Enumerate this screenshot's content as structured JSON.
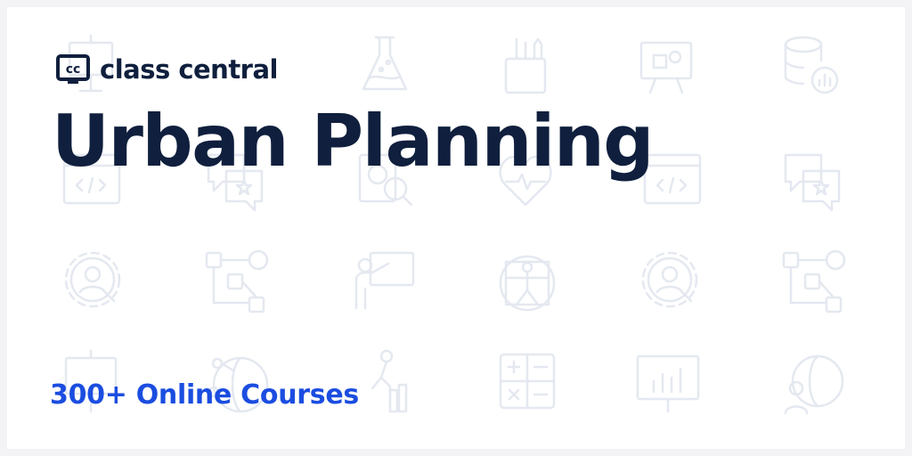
{
  "brand": {
    "name": "class central",
    "mark_text": "cc",
    "color": "#0f1f3d"
  },
  "title": "Urban Planning",
  "subtitle": "300+ Online Courses",
  "colors": {
    "background": "#ffffff",
    "frame": "#f3f3f6",
    "title": "#0f1f3d",
    "accent": "#1b4de0",
    "pattern": "#e4e8f0"
  },
  "background_icons": [
    "presentation-board-icon",
    "flask-icon",
    "pencil-cup-icon",
    "easel-shapes-icon",
    "database-chart-icon",
    "code-window-icon",
    "chat-star-icon",
    "report-search-icon",
    "heart-pulse-icon",
    "code-window-icon",
    "chat-star-icon",
    "gear-person-icon",
    "flowchart-icon",
    "teacher-board-icon",
    "vitruvian-man-icon",
    "gear-person-icon",
    "flowchart-icon",
    "presentation-icon",
    "globe-network-icon",
    "climber-icon",
    "calculator-icon",
    "bar-chart-board-icon",
    "globe-person-icon"
  ]
}
